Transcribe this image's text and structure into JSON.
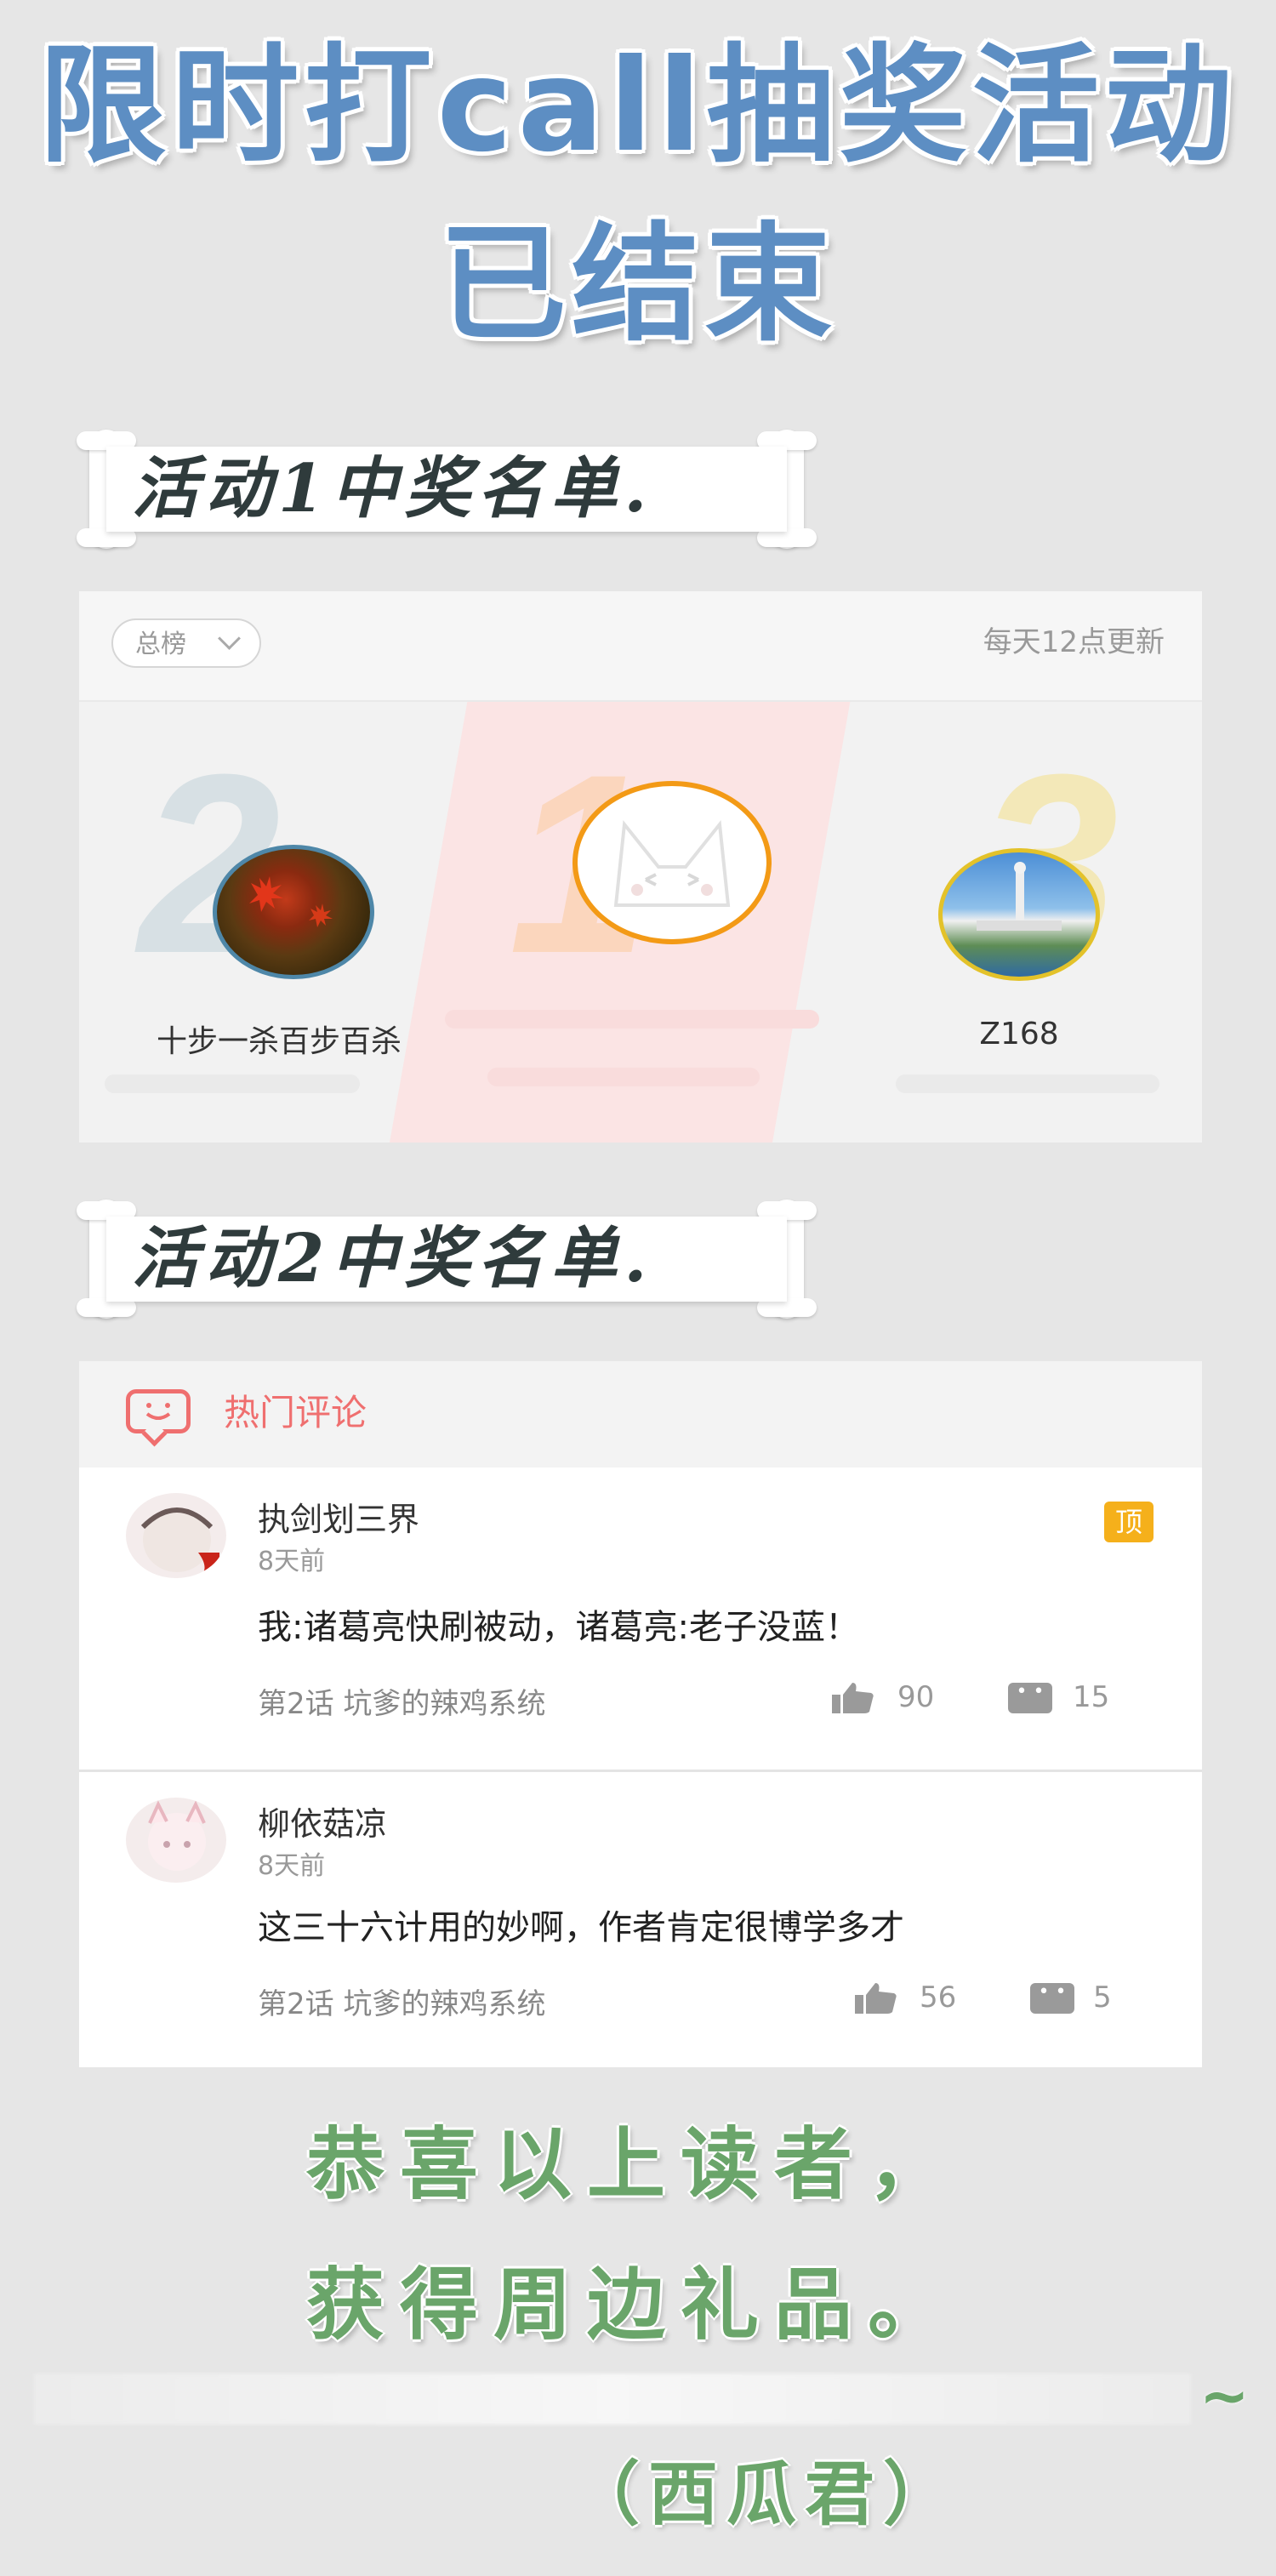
{
  "header": {
    "title_line1": "限时打call抽奖活动",
    "title_line2": "已结束"
  },
  "section1": {
    "banner": "活动1中奖名单."
  },
  "leaderboard": {
    "tab_label": "总榜",
    "update_note": "每天12点更新",
    "ranks": [
      {
        "rank": "2",
        "name": "十步一杀百步百杀"
      },
      {
        "rank": "1",
        "name": ""
      },
      {
        "rank": "3",
        "name": "Z168"
      }
    ],
    "colors": {
      "rank1_ring": "#f39a16",
      "rank2_ring": "#4e87a8",
      "rank3_ring": "#e3c22a"
    }
  },
  "section2": {
    "banner": "活动2中奖名单."
  },
  "hot_comments": {
    "title": "热门评论",
    "items": [
      {
        "user": "执剑划三界",
        "time": "8天前",
        "text": "我:诸葛亮快刷被动，诸葛亮:老子没蓝！",
        "source": "第2话 坑爹的辣鸡系统",
        "likes": "90",
        "replies": "15",
        "badge": "顶"
      },
      {
        "user": "柳依菇凉",
        "time": "8天前",
        "text": "这三十六计用的妙啊，作者肯定很博学多才",
        "source": "第2话 坑爹的辣鸡系统",
        "likes": "56",
        "replies": "5"
      }
    ]
  },
  "footer": {
    "congrats_line1": "恭喜以上读者，",
    "congrats_line2": "获得周边礼品。",
    "tilde": "~",
    "signature": "（西瓜君）"
  }
}
